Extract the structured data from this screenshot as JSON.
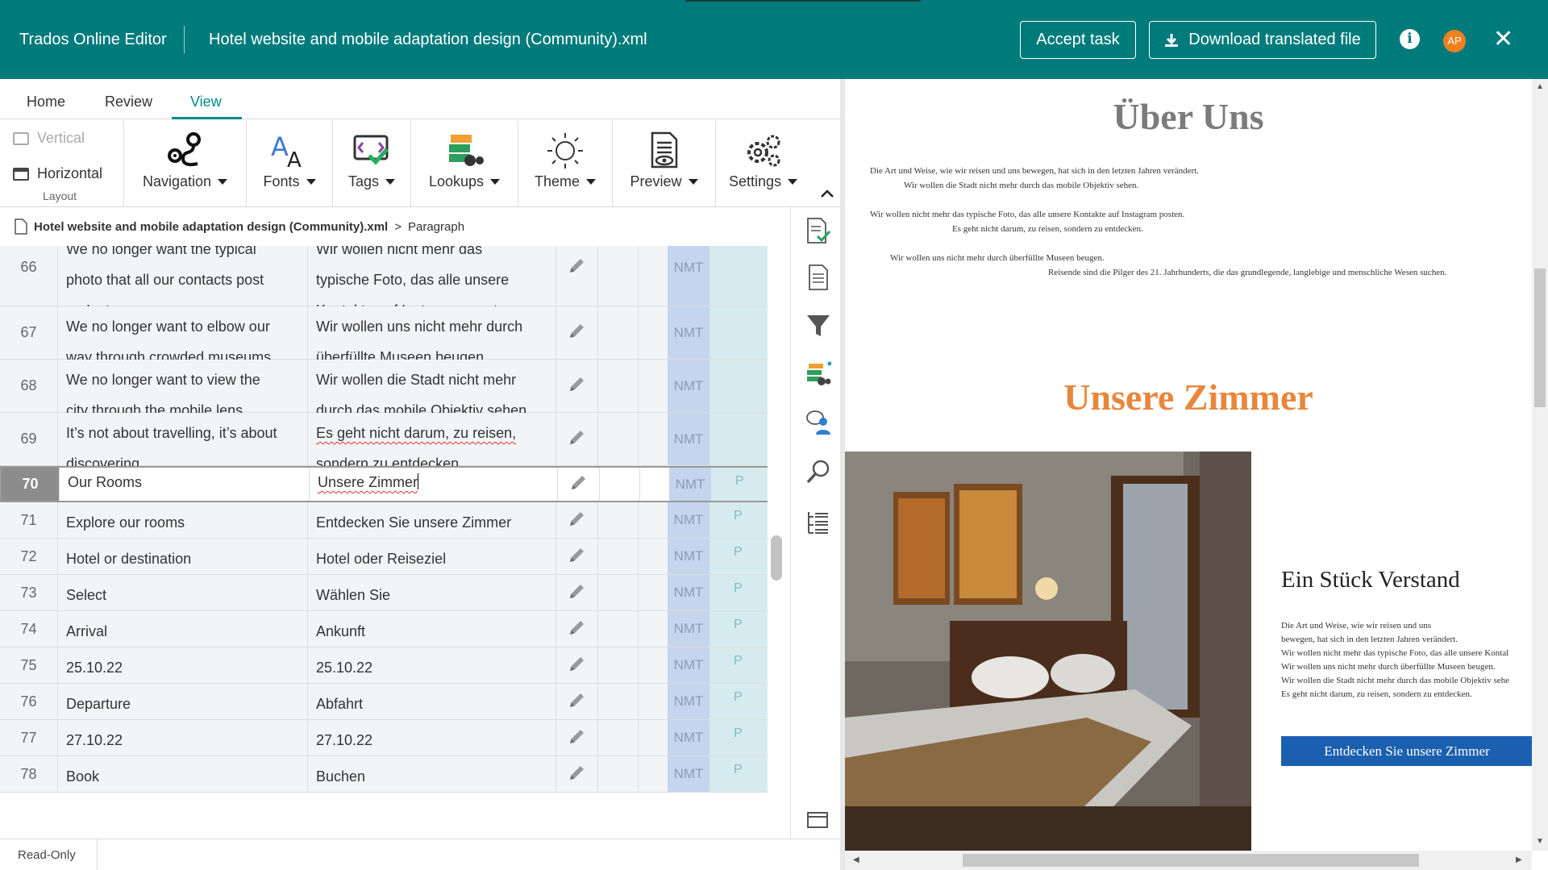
{
  "header": {
    "app_title": "Trados Online Editor",
    "file_name": "Hotel website and mobile adaptation design (Community).xml",
    "accept_label": "Accept task",
    "download_label": "Download translated file",
    "info_icon": "info-icon",
    "avatar_initials": "AP",
    "close_icon": "close-icon"
  },
  "tabs": [
    "Home",
    "Review",
    "View"
  ],
  "active_tab": "View",
  "ribbon": {
    "layout_vertical": "Vertical",
    "layout_horizontal": "Horizontal",
    "layout_group_label": "Layout",
    "buttons": [
      {
        "label": "Navigation",
        "icon": "navigation-icon"
      },
      {
        "label": "Fonts",
        "icon": "fonts-icon"
      },
      {
        "label": "Tags",
        "icon": "tags-icon"
      },
      {
        "label": "Lookups",
        "icon": "lookups-icon"
      },
      {
        "label": "Theme",
        "icon": "theme-icon"
      },
      {
        "label": "Preview",
        "icon": "preview-icon"
      },
      {
        "label": "Settings",
        "icon": "settings-icon"
      }
    ]
  },
  "breadcrumb": {
    "file": "Hotel website and mobile adaptation design (Community).xml",
    "separator": ">",
    "current": "Paragraph"
  },
  "segments": [
    {
      "num": "66",
      "source": [
        "We no longer want the typical",
        "photo that all our contacts post",
        "on Instagram."
      ],
      "target": [
        "Wir wollen nicht mehr das",
        "typische Foto, das alle unsere",
        "Kontakte auf Instagram posten."
      ],
      "origin": "NMT",
      "status": ""
    },
    {
      "num": "67",
      "source": [
        "We no longer want to elbow our",
        "way through crowded museums."
      ],
      "target": [
        "Wir wollen uns nicht mehr durch",
        "überfüllte Museen beugen."
      ],
      "origin": "NMT",
      "status": ""
    },
    {
      "num": "68",
      "source": [
        "We no longer want to view the",
        "city through the mobile lens."
      ],
      "target": [
        "Wir wollen die Stadt nicht mehr",
        "durch das mobile Objektiv sehen."
      ],
      "origin": "NMT",
      "status": ""
    },
    {
      "num": "69",
      "source": [
        "It’s not about travelling, it’s about",
        "discovering."
      ],
      "target": [
        "Es geht nicht darum, zu reisen,",
        "sondern zu entdecken."
      ],
      "origin": "NMT",
      "status": ""
    },
    {
      "num": "70",
      "source": [
        "Our Rooms"
      ],
      "target": [
        "Unsere Zimmer"
      ],
      "origin": "NMT",
      "status": "P"
    },
    {
      "num": "71",
      "source": [
        "Explore our rooms"
      ],
      "target": [
        "Entdecken Sie unsere Zimmer"
      ],
      "origin": "NMT",
      "status": "P"
    },
    {
      "num": "72",
      "source": [
        "Hotel or destination"
      ],
      "target": [
        "Hotel oder Reiseziel"
      ],
      "origin": "NMT",
      "status": "P"
    },
    {
      "num": "73",
      "source": [
        "Select"
      ],
      "target": [
        "Wählen Sie"
      ],
      "origin": "NMT",
      "status": "P"
    },
    {
      "num": "74",
      "source": [
        "Arrival"
      ],
      "target": [
        "Ankunft"
      ],
      "origin": "NMT",
      "status": "P"
    },
    {
      "num": "75",
      "source": [
        "25.10.22"
      ],
      "target": [
        "25.10.22"
      ],
      "origin": "NMT",
      "status": "P"
    },
    {
      "num": "76",
      "source": [
        "Departure"
      ],
      "target": [
        "Abfahrt"
      ],
      "origin": "NMT",
      "status": "P"
    },
    {
      "num": "77",
      "source": [
        "27.10.22"
      ],
      "target": [
        "27.10.22"
      ],
      "origin": "NMT",
      "status": "P"
    },
    {
      "num": "78",
      "source": [
        "Book"
      ],
      "target": [
        "Buchen"
      ],
      "origin": "NMT",
      "status": "P"
    }
  ],
  "status_bar": {
    "mode": "Read-Only"
  },
  "sidebar_icons": [
    "doc-check-icon",
    "document-icon",
    "filter-icon",
    "lookups-side-icon",
    "comments-icon",
    "search-icon",
    "tree-icon",
    "window-icon"
  ],
  "preview": {
    "heading1": "Über Uns",
    "para1": [
      "Die Art und Weise, wie wir reisen und uns bewegen, hat sich in den letzten Jahren verändert.",
      "Wir wollen die Stadt nicht mehr durch das mobile Objektiv sehen.",
      "Wir wollen nicht mehr das typische Foto, das alle unsere Kontakte auf Instagram posten.",
      "Es geht nicht darum, zu reisen, sondern zu entdecken.",
      "Wir wollen uns nicht mehr durch überfüllte Museen beugen.",
      "Reisende sind die Pilger des 21. Jahrhunderts, die das grundlegende, langlebige und menschliche Wesen suchen."
    ],
    "heading2": "Unsere Zimmer",
    "heading3": "Ein Stück Verstand",
    "para2": [
      "Die Art und Weise, wie wir reisen und uns",
      "bewegen, hat sich in den letzten Jahren verändert.",
      "Wir wollen nicht mehr das typische Foto, das alle unsere Kontal",
      "Wir wollen uns nicht mehr durch überfüllte Museen beugen.",
      "Wir wollen die Stadt nicht mehr durch das mobile Objektiv sehe",
      "Es geht nicht darum, zu reisen, sondern zu entdecken."
    ],
    "button": "Entdecken Sie unsere Zimmer"
  },
  "colors": {
    "header": "#007b7c",
    "active_tab": "#00888a",
    "nmt_cell": "#c5d5ee",
    "status_cell": "#d5ebef",
    "heading2": "#e8873c",
    "cta": "#1b5fb0",
    "avatar": "#f07f1e"
  }
}
